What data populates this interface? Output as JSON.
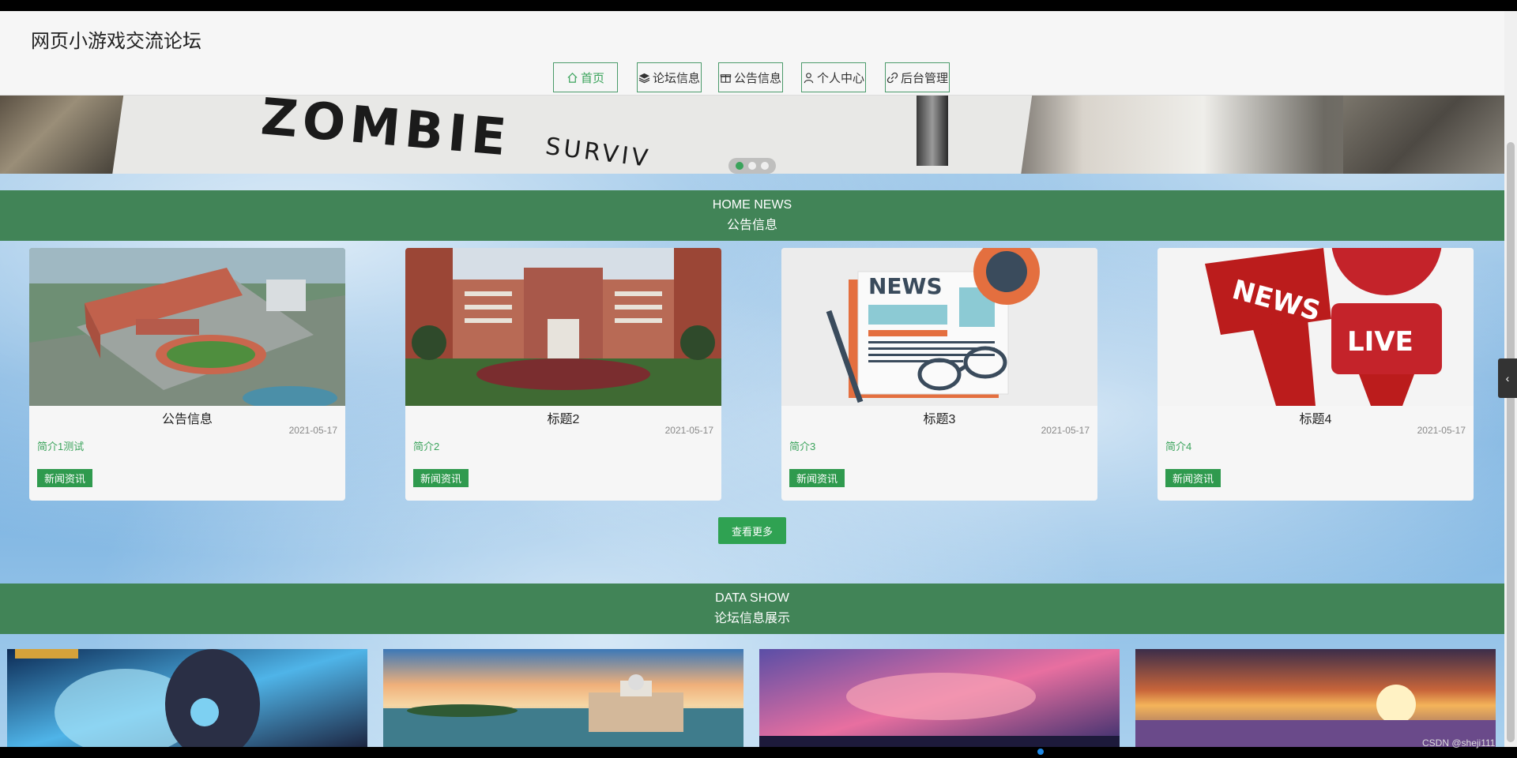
{
  "header": {
    "site_title": "网页小游戏交流论坛",
    "nav": [
      {
        "label": "首页",
        "icon": "home-icon",
        "active": true
      },
      {
        "label": "论坛信息",
        "icon": "layers-icon",
        "active": false
      },
      {
        "label": "公告信息",
        "icon": "gift-icon",
        "active": false
      },
      {
        "label": "个人中心",
        "icon": "user-icon",
        "active": false
      },
      {
        "label": "后台管理",
        "icon": "link-icon",
        "active": false
      }
    ]
  },
  "banner": {
    "text_main": "ZOMBIE",
    "text_sub": "SURVIV",
    "dots": 3,
    "active_dot": 1
  },
  "news_section": {
    "title_en": "HOME NEWS",
    "title_cn": "公告信息",
    "cards": [
      {
        "title": "公告信息",
        "date": "2021-05-17",
        "intro": "简介1测试",
        "tag": "新闻资讯"
      },
      {
        "title": "标题2",
        "date": "2021-05-17",
        "intro": "简介2",
        "tag": "新闻资讯"
      },
      {
        "title": "标题3",
        "date": "2021-05-17",
        "intro": "简介3",
        "tag": "新闻资讯",
        "img_text": "NEWS"
      },
      {
        "title": "标题4",
        "date": "2021-05-17",
        "intro": "简介4",
        "tag": "新闻资讯",
        "img_text": "NEWS",
        "img_text2": "LIVE"
      }
    ],
    "more_label": "查看更多"
  },
  "forum_section": {
    "title_en": "DATA SHOW",
    "title_cn": "论坛信息展示"
  },
  "side_tab_icon": "chevron-left-icon",
  "side_tab_glyph": "‹",
  "watermark": "CSDN @sheji111",
  "colors": {
    "accent": "#418457",
    "button_green": "#2fa252",
    "intro_green": "#3aa35b"
  }
}
